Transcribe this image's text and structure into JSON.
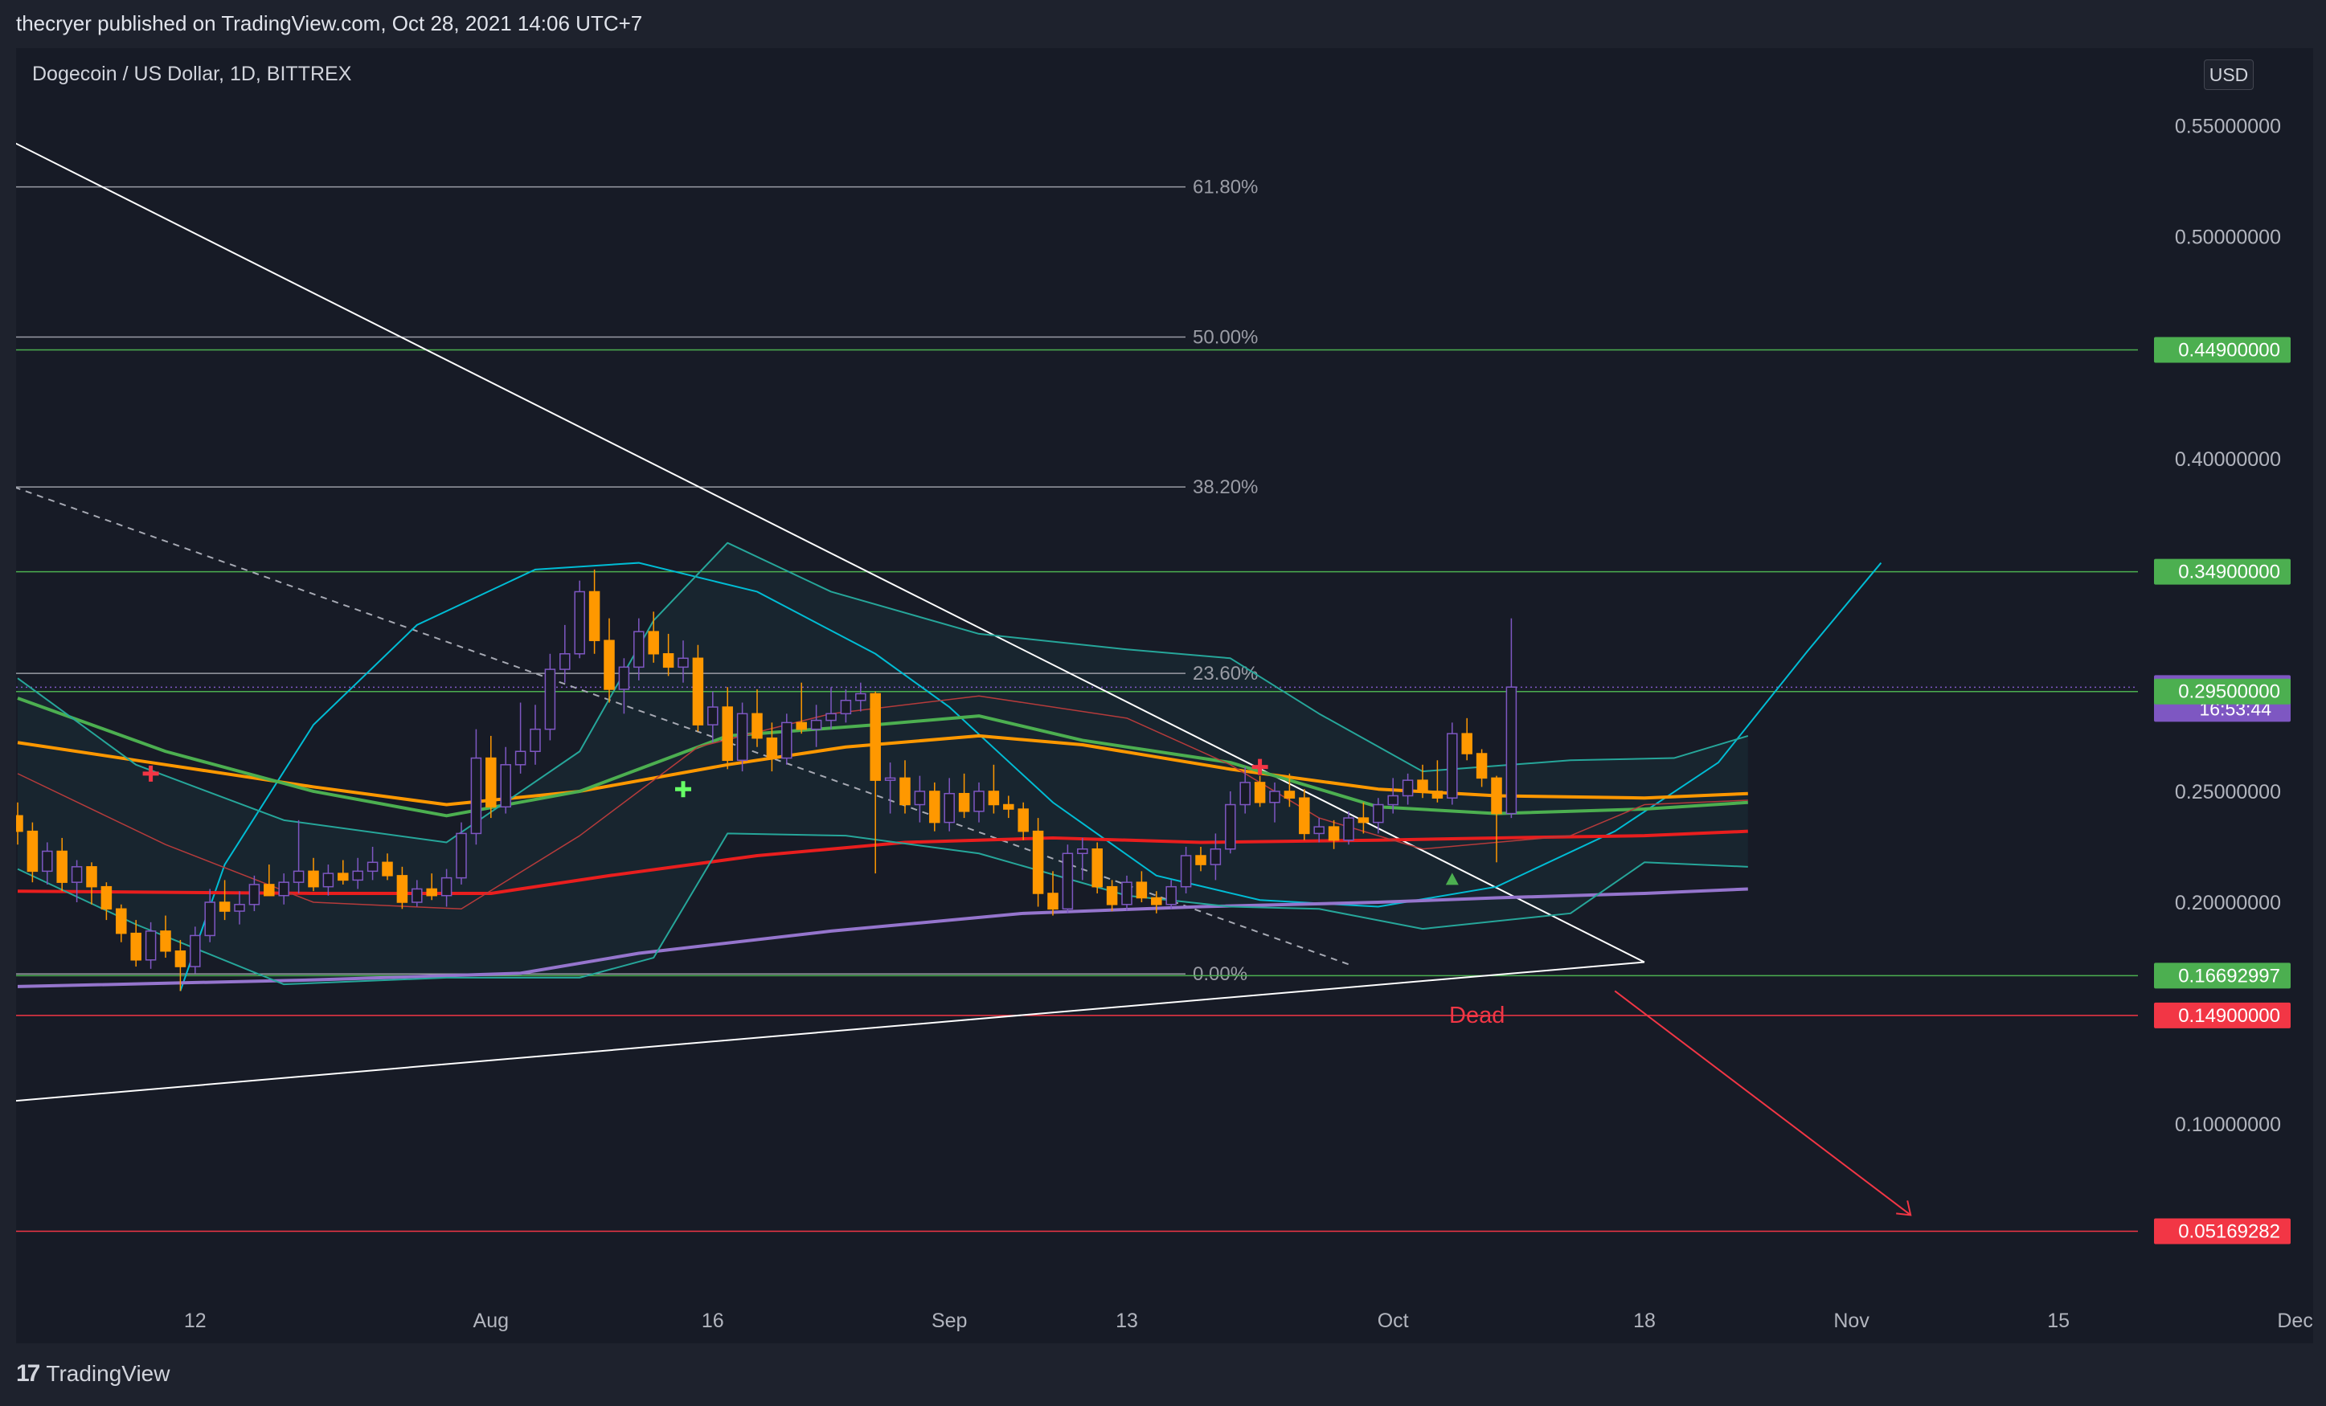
{
  "header": {
    "published": "thecryer published on TradingView.com, Oct 28, 2021 14:06 UTC+7"
  },
  "symbol": {
    "title": "Dogecoin / US Dollar, 1D, BITTREX",
    "currency": "USD"
  },
  "footer": {
    "brand": "TradingView"
  },
  "chart_data": {
    "type": "candlestick",
    "ylim": [
      0.02,
      0.585
    ],
    "y_ticks": [
      {
        "value": 0.55,
        "label": "0.55000000"
      },
      {
        "value": 0.5,
        "label": "0.50000000"
      },
      {
        "value": 0.4,
        "label": "0.40000000"
      },
      {
        "value": 0.25,
        "label": "0.25000000"
      },
      {
        "value": 0.2,
        "label": "0.20000000"
      },
      {
        "value": 0.1,
        "label": "0.10000000"
      }
    ],
    "x_ticks": [
      {
        "day": 12,
        "label": "12"
      },
      {
        "day": 32,
        "label": "Aug"
      },
      {
        "day": 47,
        "label": "16"
      },
      {
        "day": 63,
        "label": "Sep"
      },
      {
        "day": 75,
        "label": "13"
      },
      {
        "day": 93,
        "label": "Oct"
      },
      {
        "day": 110,
        "label": "18"
      },
      {
        "day": 124,
        "label": "Nov"
      },
      {
        "day": 138,
        "label": "15"
      },
      {
        "day": 154,
        "label": "Dec"
      }
    ],
    "price_labels": [
      {
        "value": 0.449,
        "label": "0.44900000",
        "color": "#4caf50"
      },
      {
        "value": 0.349,
        "label": "0.34900000",
        "color": "#4caf50"
      },
      {
        "value": 0.29692,
        "label": "0.29692000",
        "sub": "16:53:44",
        "color": "#7e57c2"
      },
      {
        "value": 0.295,
        "label": "0.29500000",
        "color": "#4caf50"
      },
      {
        "value": 0.16692997,
        "label": "0.16692997",
        "color": "#4caf50"
      },
      {
        "value": 0.149,
        "label": "0.14900000",
        "color": "#f23645"
      },
      {
        "value": 0.05169282,
        "label": "0.05169282",
        "color": "#f23645"
      }
    ],
    "fib_levels": [
      {
        "value": 0.5225,
        "label": "61.80%"
      },
      {
        "value": 0.4548,
        "label": "50.00%"
      },
      {
        "value": 0.3872,
        "label": "38.20%"
      },
      {
        "value": 0.3032,
        "label": "23.60%"
      },
      {
        "value": 0.1677,
        "label": "0.00%"
      }
    ],
    "annotation": "Dead",
    "candles": [
      [
        0.239,
        0.245,
        0.226,
        0.232
      ],
      [
        0.232,
        0.236,
        0.209,
        0.214
      ],
      [
        0.214,
        0.227,
        0.208,
        0.223
      ],
      [
        0.223,
        0.229,
        0.205,
        0.209
      ],
      [
        0.209,
        0.219,
        0.2,
        0.216
      ],
      [
        0.216,
        0.218,
        0.199,
        0.207
      ],
      [
        0.207,
        0.209,
        0.192,
        0.197
      ],
      [
        0.197,
        0.199,
        0.182,
        0.186
      ],
      [
        0.186,
        0.192,
        0.171,
        0.174
      ],
      [
        0.174,
        0.191,
        0.17,
        0.187
      ],
      [
        0.187,
        0.194,
        0.175,
        0.178
      ],
      [
        0.178,
        0.183,
        0.16,
        0.171
      ],
      [
        0.171,
        0.189,
        0.168,
        0.185
      ],
      [
        0.185,
        0.206,
        0.182,
        0.2
      ],
      [
        0.2,
        0.21,
        0.192,
        0.196
      ],
      [
        0.196,
        0.205,
        0.19,
        0.199
      ],
      [
        0.199,
        0.212,
        0.196,
        0.208
      ],
      [
        0.208,
        0.217,
        0.203,
        0.203
      ],
      [
        0.203,
        0.213,
        0.199,
        0.209
      ],
      [
        0.209,
        0.237,
        0.204,
        0.214
      ],
      [
        0.214,
        0.22,
        0.205,
        0.207
      ],
      [
        0.207,
        0.217,
        0.203,
        0.213
      ],
      [
        0.213,
        0.219,
        0.208,
        0.21
      ],
      [
        0.21,
        0.22,
        0.206,
        0.214
      ],
      [
        0.214,
        0.225,
        0.21,
        0.218
      ],
      [
        0.218,
        0.222,
        0.21,
        0.212
      ],
      [
        0.212,
        0.216,
        0.197,
        0.2
      ],
      [
        0.2,
        0.21,
        0.198,
        0.206
      ],
      [
        0.206,
        0.213,
        0.201,
        0.203
      ],
      [
        0.203,
        0.215,
        0.198,
        0.211
      ],
      [
        0.211,
        0.236,
        0.208,
        0.231
      ],
      [
        0.231,
        0.278,
        0.226,
        0.265
      ],
      [
        0.265,
        0.275,
        0.238,
        0.243
      ],
      [
        0.243,
        0.27,
        0.24,
        0.262
      ],
      [
        0.262,
        0.29,
        0.258,
        0.268
      ],
      [
        0.268,
        0.289,
        0.262,
        0.278
      ],
      [
        0.278,
        0.312,
        0.273,
        0.305
      ],
      [
        0.305,
        0.325,
        0.299,
        0.312
      ],
      [
        0.312,
        0.345,
        0.31,
        0.34
      ],
      [
        0.34,
        0.35,
        0.312,
        0.318
      ],
      [
        0.318,
        0.328,
        0.29,
        0.296
      ],
      [
        0.296,
        0.31,
        0.285,
        0.306
      ],
      [
        0.306,
        0.328,
        0.3,
        0.322
      ],
      [
        0.322,
        0.331,
        0.308,
        0.312
      ],
      [
        0.312,
        0.321,
        0.302,
        0.306
      ],
      [
        0.306,
        0.318,
        0.299,
        0.31
      ],
      [
        0.31,
        0.316,
        0.277,
        0.28
      ],
      [
        0.28,
        0.295,
        0.272,
        0.288
      ],
      [
        0.288,
        0.297,
        0.26,
        0.264
      ],
      [
        0.264,
        0.29,
        0.259,
        0.285
      ],
      [
        0.285,
        0.296,
        0.27,
        0.274
      ],
      [
        0.274,
        0.281,
        0.259,
        0.265
      ],
      [
        0.265,
        0.285,
        0.262,
        0.281
      ],
      [
        0.281,
        0.299,
        0.276,
        0.278
      ],
      [
        0.278,
        0.289,
        0.27,
        0.282
      ],
      [
        0.282,
        0.297,
        0.278,
        0.285
      ],
      [
        0.285,
        0.296,
        0.281,
        0.291
      ],
      [
        0.291,
        0.299,
        0.286,
        0.294
      ],
      [
        0.294,
        0.295,
        0.213,
        0.255
      ],
      [
        0.255,
        0.263,
        0.24,
        0.256
      ],
      [
        0.256,
        0.264,
        0.24,
        0.244
      ],
      [
        0.244,
        0.257,
        0.236,
        0.25
      ],
      [
        0.25,
        0.254,
        0.232,
        0.236
      ],
      [
        0.236,
        0.256,
        0.232,
        0.249
      ],
      [
        0.249,
        0.258,
        0.238,
        0.241
      ],
      [
        0.241,
        0.254,
        0.236,
        0.25
      ],
      [
        0.25,
        0.262,
        0.24,
        0.244
      ],
      [
        0.244,
        0.248,
        0.238,
        0.242
      ],
      [
        0.242,
        0.245,
        0.228,
        0.232
      ],
      [
        0.232,
        0.238,
        0.198,
        0.204
      ],
      [
        0.204,
        0.214,
        0.194,
        0.197
      ],
      [
        0.197,
        0.226,
        0.195,
        0.222
      ],
      [
        0.222,
        0.229,
        0.21,
        0.224
      ],
      [
        0.224,
        0.227,
        0.204,
        0.207
      ],
      [
        0.207,
        0.21,
        0.196,
        0.199
      ],
      [
        0.199,
        0.212,
        0.196,
        0.209
      ],
      [
        0.209,
        0.214,
        0.2,
        0.202
      ],
      [
        0.202,
        0.205,
        0.195,
        0.199
      ],
      [
        0.199,
        0.21,
        0.197,
        0.207
      ],
      [
        0.207,
        0.225,
        0.204,
        0.221
      ],
      [
        0.221,
        0.225,
        0.214,
        0.217
      ],
      [
        0.217,
        0.231,
        0.21,
        0.224
      ],
      [
        0.224,
        0.25,
        0.222,
        0.244
      ],
      [
        0.244,
        0.261,
        0.24,
        0.254
      ],
      [
        0.254,
        0.257,
        0.243,
        0.245
      ],
      [
        0.245,
        0.254,
        0.236,
        0.25
      ],
      [
        0.25,
        0.258,
        0.243,
        0.247
      ],
      [
        0.247,
        0.251,
        0.228,
        0.231
      ],
      [
        0.231,
        0.238,
        0.227,
        0.234
      ],
      [
        0.234,
        0.237,
        0.224,
        0.228
      ],
      [
        0.228,
        0.241,
        0.226,
        0.238
      ],
      [
        0.238,
        0.245,
        0.231,
        0.236
      ],
      [
        0.236,
        0.247,
        0.231,
        0.244
      ],
      [
        0.244,
        0.256,
        0.24,
        0.248
      ],
      [
        0.248,
        0.258,
        0.244,
        0.255
      ],
      [
        0.255,
        0.262,
        0.247,
        0.25
      ],
      [
        0.25,
        0.264,
        0.245,
        0.247
      ],
      [
        0.247,
        0.281,
        0.244,
        0.276
      ],
      [
        0.276,
        0.283,
        0.264,
        0.267
      ],
      [
        0.267,
        0.269,
        0.252,
        0.256
      ],
      [
        0.256,
        0.257,
        0.218,
        0.24
      ],
      [
        0.24,
        0.328,
        0.238,
        0.297
      ]
    ],
    "series": [
      {
        "name": "",
        "color": "#ff9800",
        "width": 4,
        "points": [
          [
            0,
            0.272
          ],
          [
            10,
            0.262
          ],
          [
            20,
            0.252
          ],
          [
            29,
            0.244
          ],
          [
            38,
            0.25
          ],
          [
            48,
            0.262
          ],
          [
            56,
            0.27
          ],
          [
            65,
            0.275
          ],
          [
            72,
            0.271
          ],
          [
            82,
            0.26
          ],
          [
            92,
            0.251
          ],
          [
            100,
            0.248
          ],
          [
            110,
            0.247
          ],
          [
            117,
            0.249
          ]
        ]
      },
      {
        "name": "",
        "color": "#4caf50",
        "width": 4,
        "points": [
          [
            0,
            0.292
          ],
          [
            10,
            0.268
          ],
          [
            20,
            0.25
          ],
          [
            29,
            0.239
          ],
          [
            38,
            0.25
          ],
          [
            48,
            0.275
          ],
          [
            58,
            0.28
          ],
          [
            65,
            0.284
          ],
          [
            72,
            0.273
          ],
          [
            82,
            0.263
          ],
          [
            92,
            0.243
          ],
          [
            100,
            0.24
          ],
          [
            110,
            0.242
          ],
          [
            117,
            0.245
          ]
        ]
      },
      {
        "name": "",
        "color": "#e91e1e",
        "width": 4,
        "points": [
          [
            0,
            0.205
          ],
          [
            20,
            0.204
          ],
          [
            32,
            0.204
          ],
          [
            40,
            0.212
          ],
          [
            50,
            0.221
          ],
          [
            60,
            0.227
          ],
          [
            70,
            0.229
          ],
          [
            80,
            0.227
          ],
          [
            92,
            0.228
          ],
          [
            100,
            0.229
          ],
          [
            110,
            0.23
          ],
          [
            117,
            0.232
          ]
        ]
      },
      {
        "name": "",
        "color": "#9575cd",
        "width": 4,
        "points": [
          [
            0,
            0.162
          ],
          [
            20,
            0.165
          ],
          [
            34,
            0.168
          ],
          [
            42,
            0.177
          ],
          [
            55,
            0.187
          ],
          [
            68,
            0.195
          ],
          [
            80,
            0.198
          ],
          [
            92,
            0.2
          ],
          [
            100,
            0.202
          ],
          [
            110,
            0.204
          ],
          [
            117,
            0.206
          ]
        ]
      },
      {
        "name": "",
        "color": "#26a69a",
        "width": 2,
        "points": [
          [
            0,
            0.301
          ],
          [
            8,
            0.262
          ],
          [
            18,
            0.237
          ],
          [
            29,
            0.227
          ],
          [
            38,
            0.268
          ],
          [
            43,
            0.327
          ],
          [
            48,
            0.362
          ],
          [
            55,
            0.34
          ],
          [
            65,
            0.321
          ],
          [
            75,
            0.314
          ],
          [
            82,
            0.31
          ],
          [
            88,
            0.285
          ],
          [
            95,
            0.259
          ],
          [
            105,
            0.264
          ],
          [
            112,
            0.265
          ],
          [
            117,
            0.275
          ]
        ]
      },
      {
        "name": "",
        "color": "#26a69a",
        "width": 2,
        "points": [
          [
            0,
            0.215
          ],
          [
            8,
            0.19
          ],
          [
            18,
            0.163
          ],
          [
            29,
            0.166
          ],
          [
            38,
            0.166
          ],
          [
            43,
            0.175
          ],
          [
            48,
            0.231
          ],
          [
            56,
            0.23
          ],
          [
            65,
            0.222
          ],
          [
            75,
            0.203
          ],
          [
            82,
            0.198
          ],
          [
            88,
            0.197
          ],
          [
            95,
            0.188
          ],
          [
            105,
            0.195
          ],
          [
            110,
            0.218
          ],
          [
            117,
            0.216
          ]
        ]
      },
      {
        "name": "",
        "color": "#b53b3b",
        "width": 1.5,
        "points": [
          [
            0,
            0.258
          ],
          [
            10,
            0.226
          ],
          [
            20,
            0.2
          ],
          [
            30,
            0.197
          ],
          [
            38,
            0.23
          ],
          [
            46,
            0.27
          ],
          [
            55,
            0.285
          ],
          [
            65,
            0.293
          ],
          [
            75,
            0.283
          ],
          [
            82,
            0.262
          ],
          [
            88,
            0.238
          ],
          [
            95,
            0.224
          ],
          [
            105,
            0.23
          ],
          [
            110,
            0.244
          ],
          [
            117,
            0.246
          ]
        ]
      }
    ],
    "arc": [
      [
        11,
        0.16
      ],
      [
        14,
        0.217
      ],
      [
        20,
        0.28
      ],
      [
        27,
        0.325
      ],
      [
        35,
        0.35
      ],
      [
        42,
        0.353
      ],
      [
        50,
        0.34
      ],
      [
        58,
        0.312
      ],
      [
        63,
        0.288
      ],
      [
        70,
        0.245
      ],
      [
        77,
        0.212
      ],
      [
        84,
        0.201
      ],
      [
        92,
        0.198
      ],
      [
        100,
        0.207
      ],
      [
        108,
        0.232
      ],
      [
        115,
        0.263
      ],
      [
        121,
        0.313
      ],
      [
        126,
        0.353
      ]
    ],
    "markers": [
      {
        "day": 9,
        "value": 0.258,
        "color": "#f23645",
        "shape": "cross"
      },
      {
        "day": 45,
        "value": 0.251,
        "color": "#66ff66",
        "shape": "cross"
      },
      {
        "day": 84,
        "value": 0.261,
        "color": "#f23645",
        "shape": "cross"
      },
      {
        "day": 97,
        "value": 0.21,
        "color": "#4caf50",
        "shape": "triangle"
      }
    ],
    "lines": [
      {
        "name": "descending-trendline",
        "color": "#ffffff",
        "width": 2,
        "dash": "",
        "points": [
          [
            -1,
            0.545
          ],
          [
            110,
            0.173
          ]
        ]
      },
      {
        "name": "rising-trendline",
        "color": "#ffffff",
        "width": 2,
        "dash": "",
        "points": [
          [
            -1,
            0.11
          ],
          [
            110,
            0.173
          ]
        ]
      },
      {
        "name": "dashed-trendline",
        "color": "#a6a9b3",
        "width": 2,
        "dash": "8,7",
        "points": [
          [
            -1,
            0.389
          ],
          [
            90,
            0.172
          ]
        ]
      },
      {
        "name": "target-arrow",
        "color": "#f23645",
        "width": 2,
        "dash": "",
        "points": [
          [
            108,
            0.16
          ],
          [
            128,
            0.059
          ]
        ]
      }
    ]
  }
}
